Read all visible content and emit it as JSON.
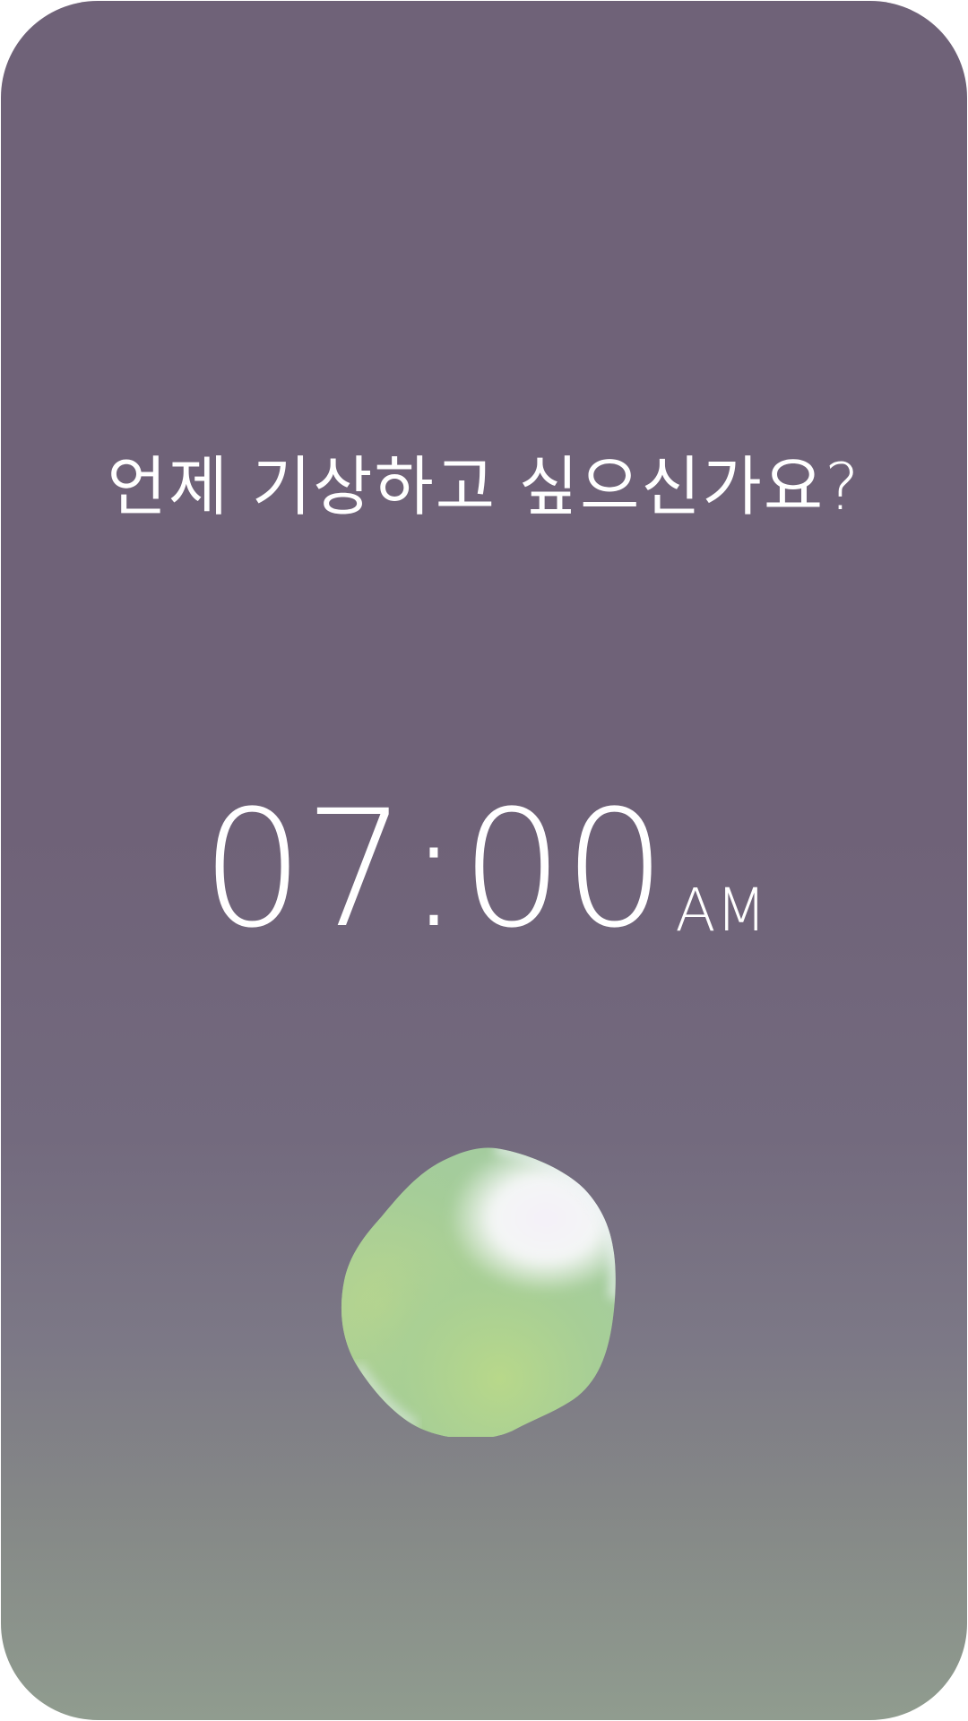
{
  "prompt": {
    "question": "언제 기상하고 싶으신가요?"
  },
  "alarm": {
    "time": "07:00",
    "meridiem": "AM"
  },
  "colors": {
    "background_top": "#6f6278",
    "background_bottom": "#909c8f",
    "text": "#ffffff",
    "orb_green": "#a8cf8f",
    "orb_white": "#f7f6fb"
  }
}
